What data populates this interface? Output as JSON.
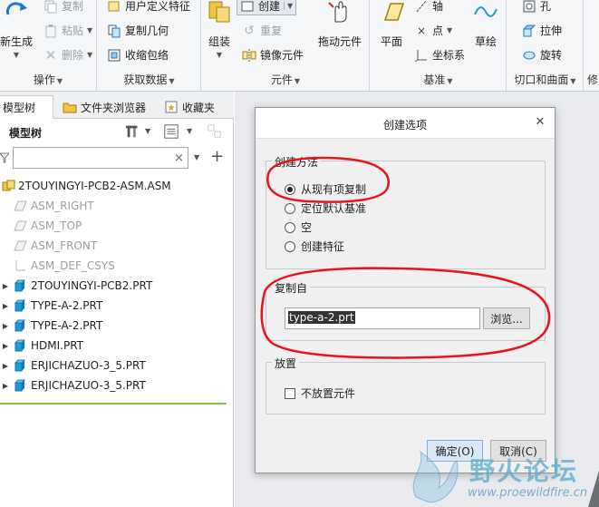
{
  "ribbon": {
    "operations": {
      "label": "操作",
      "regenerate_label": "新生成",
      "copy_label": "复制",
      "paste_label": "粘贴",
      "delete_label": "删除"
    },
    "get_data": {
      "label": "获取数据",
      "udf_label": "用户定义特征",
      "copy_geom_label": "复制几何",
      "shrinkwrap_label": "收缩包络"
    },
    "component": {
      "label": "元件",
      "assemble_label": "组装",
      "create_label": "创建",
      "repeat_label": "重复",
      "mirror_label": "镜像元件",
      "drag_label": "拖动元件"
    },
    "datum": {
      "label": "基准",
      "plane_label": "平面",
      "axis_label": "轴",
      "point_label": "点",
      "csys_label": "坐标系",
      "sketch_label": "草绘"
    },
    "cut_surface": {
      "label": "切口和曲面",
      "hole_label": "孔",
      "extrude_label": "拉伸",
      "revolve_label": "旋转"
    },
    "modifiers_partial_label": "修"
  },
  "left_panel": {
    "tabs": [
      {
        "label": "模型树"
      },
      {
        "label": "文件夹浏览器"
      },
      {
        "label": "收藏夹"
      }
    ],
    "tree_title": "模型树",
    "filter_value": "",
    "tree_items": [
      {
        "label": "2TOUYINGYI-PCB2-ASM.ASM",
        "type": "assembly"
      },
      {
        "label": "ASM_RIGHT",
        "type": "datum-plane"
      },
      {
        "label": "ASM_TOP",
        "type": "datum-plane"
      },
      {
        "label": "ASM_FRONT",
        "type": "datum-plane"
      },
      {
        "label": "ASM_DEF_CSYS",
        "type": "csys"
      },
      {
        "label": "2TOUYINGYI-PCB2.PRT",
        "type": "part"
      },
      {
        "label": "TYPE-A-2.PRT",
        "type": "part"
      },
      {
        "label": "TYPE-A-2.PRT",
        "type": "part"
      },
      {
        "label": "HDMI.PRT",
        "type": "part"
      },
      {
        "label": "ERJICHAZUO-3_5.PRT",
        "type": "part"
      },
      {
        "label": "ERJICHAZUO-3_5.PRT",
        "type": "part"
      }
    ]
  },
  "dialog": {
    "title": "创建选项",
    "creation_method": {
      "legend": "创建方法",
      "options": [
        {
          "label": "从现有项复制",
          "selected": true
        },
        {
          "label": "定位默认基准",
          "selected": false
        },
        {
          "label": "空",
          "selected": false
        },
        {
          "label": "创建特征",
          "selected": false
        }
      ]
    },
    "copy_from": {
      "legend": "复制自",
      "value": "type-a-2.prt",
      "browse_label": "浏览..."
    },
    "placement": {
      "legend": "放置",
      "no_place_label": "不放置元件",
      "no_place_checked": false
    },
    "ok_label": "确定(O)",
    "cancel_label": "取消(C)"
  },
  "watermark": {
    "logo_text": "野火论坛",
    "url": "www.proewildfire.cn"
  },
  "colors": {
    "annotation_red": "#e8141c",
    "tree_separator": "#7fc241",
    "part_icon": "#1e9ad6"
  }
}
